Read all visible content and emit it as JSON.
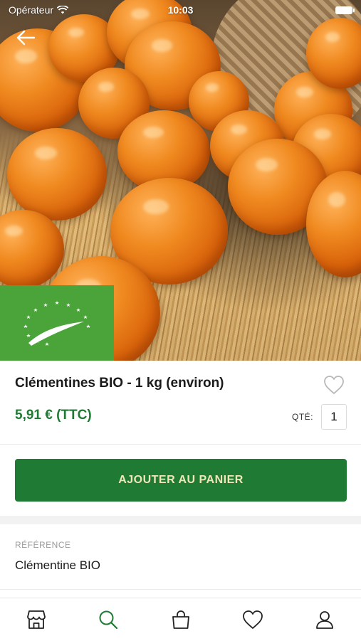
{
  "status_bar": {
    "carrier": "Opérateur",
    "time": "10:03",
    "wifi_icon": "wifi-icon",
    "battery_icon": "battery-icon"
  },
  "header": {
    "back_icon": "arrow-left-icon"
  },
  "product": {
    "image_subject": "clementines",
    "badge_icon": "eu-organic-leaf-icon",
    "title": "Clémentines BIO - 1 kg (environ)",
    "price": "5,91 € (TTC)",
    "favorite_icon": "heart-outline-icon",
    "quantity_label": "QTÉ:",
    "quantity_value": "1"
  },
  "actions": {
    "add_to_cart_label": "AJOUTER AU PANIER"
  },
  "details": {
    "reference_label": "RÉFÉRENCE",
    "reference_value": "Clémentine BIO"
  },
  "tabbar": {
    "items": [
      {
        "icon": "store-icon",
        "active": false
      },
      {
        "icon": "search-icon",
        "active": true
      },
      {
        "icon": "bag-icon",
        "active": false
      },
      {
        "icon": "heart-icon",
        "active": false
      },
      {
        "icon": "user-icon",
        "active": false
      }
    ]
  },
  "colors": {
    "brand_green": "#1f7a34",
    "button_text": "#f0e6b8",
    "organic_badge": "#4aa43a",
    "tab_active": "#1f7a34",
    "tab_inactive": "#222222"
  }
}
